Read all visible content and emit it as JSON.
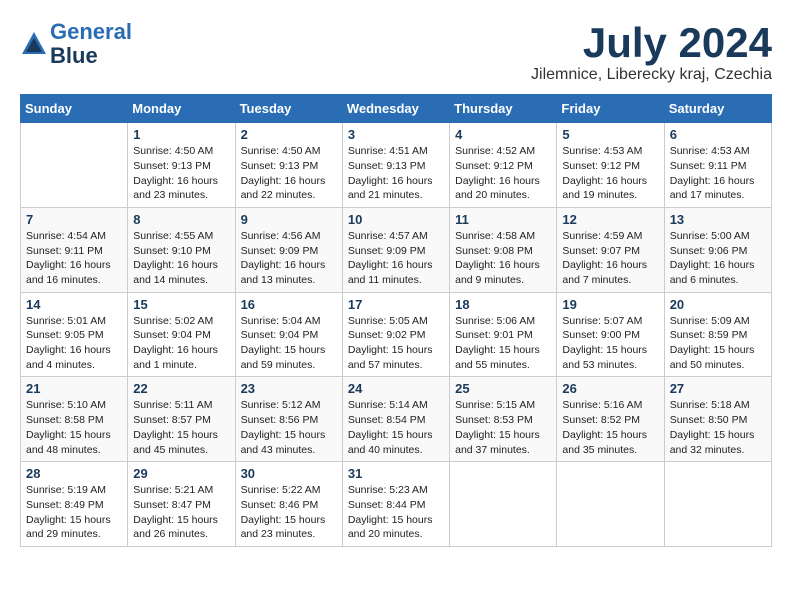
{
  "header": {
    "logo_line1": "General",
    "logo_line2": "Blue",
    "month": "July 2024",
    "location": "Jilemnice, Liberecky kraj, Czechia"
  },
  "weekdays": [
    "Sunday",
    "Monday",
    "Tuesday",
    "Wednesday",
    "Thursday",
    "Friday",
    "Saturday"
  ],
  "weeks": [
    [
      {
        "num": "",
        "text": ""
      },
      {
        "num": "1",
        "text": "Sunrise: 4:50 AM\nSunset: 9:13 PM\nDaylight: 16 hours\nand 23 minutes."
      },
      {
        "num": "2",
        "text": "Sunrise: 4:50 AM\nSunset: 9:13 PM\nDaylight: 16 hours\nand 22 minutes."
      },
      {
        "num": "3",
        "text": "Sunrise: 4:51 AM\nSunset: 9:13 PM\nDaylight: 16 hours\nand 21 minutes."
      },
      {
        "num": "4",
        "text": "Sunrise: 4:52 AM\nSunset: 9:12 PM\nDaylight: 16 hours\nand 20 minutes."
      },
      {
        "num": "5",
        "text": "Sunrise: 4:53 AM\nSunset: 9:12 PM\nDaylight: 16 hours\nand 19 minutes."
      },
      {
        "num": "6",
        "text": "Sunrise: 4:53 AM\nSunset: 9:11 PM\nDaylight: 16 hours\nand 17 minutes."
      }
    ],
    [
      {
        "num": "7",
        "text": "Sunrise: 4:54 AM\nSunset: 9:11 PM\nDaylight: 16 hours\nand 16 minutes."
      },
      {
        "num": "8",
        "text": "Sunrise: 4:55 AM\nSunset: 9:10 PM\nDaylight: 16 hours\nand 14 minutes."
      },
      {
        "num": "9",
        "text": "Sunrise: 4:56 AM\nSunset: 9:09 PM\nDaylight: 16 hours\nand 13 minutes."
      },
      {
        "num": "10",
        "text": "Sunrise: 4:57 AM\nSunset: 9:09 PM\nDaylight: 16 hours\nand 11 minutes."
      },
      {
        "num": "11",
        "text": "Sunrise: 4:58 AM\nSunset: 9:08 PM\nDaylight: 16 hours\nand 9 minutes."
      },
      {
        "num": "12",
        "text": "Sunrise: 4:59 AM\nSunset: 9:07 PM\nDaylight: 16 hours\nand 7 minutes."
      },
      {
        "num": "13",
        "text": "Sunrise: 5:00 AM\nSunset: 9:06 PM\nDaylight: 16 hours\nand 6 minutes."
      }
    ],
    [
      {
        "num": "14",
        "text": "Sunrise: 5:01 AM\nSunset: 9:05 PM\nDaylight: 16 hours\nand 4 minutes."
      },
      {
        "num": "15",
        "text": "Sunrise: 5:02 AM\nSunset: 9:04 PM\nDaylight: 16 hours\nand 1 minute."
      },
      {
        "num": "16",
        "text": "Sunrise: 5:04 AM\nSunset: 9:04 PM\nDaylight: 15 hours\nand 59 minutes."
      },
      {
        "num": "17",
        "text": "Sunrise: 5:05 AM\nSunset: 9:02 PM\nDaylight: 15 hours\nand 57 minutes."
      },
      {
        "num": "18",
        "text": "Sunrise: 5:06 AM\nSunset: 9:01 PM\nDaylight: 15 hours\nand 55 minutes."
      },
      {
        "num": "19",
        "text": "Sunrise: 5:07 AM\nSunset: 9:00 PM\nDaylight: 15 hours\nand 53 minutes."
      },
      {
        "num": "20",
        "text": "Sunrise: 5:09 AM\nSunset: 8:59 PM\nDaylight: 15 hours\nand 50 minutes."
      }
    ],
    [
      {
        "num": "21",
        "text": "Sunrise: 5:10 AM\nSunset: 8:58 PM\nDaylight: 15 hours\nand 48 minutes."
      },
      {
        "num": "22",
        "text": "Sunrise: 5:11 AM\nSunset: 8:57 PM\nDaylight: 15 hours\nand 45 minutes."
      },
      {
        "num": "23",
        "text": "Sunrise: 5:12 AM\nSunset: 8:56 PM\nDaylight: 15 hours\nand 43 minutes."
      },
      {
        "num": "24",
        "text": "Sunrise: 5:14 AM\nSunset: 8:54 PM\nDaylight: 15 hours\nand 40 minutes."
      },
      {
        "num": "25",
        "text": "Sunrise: 5:15 AM\nSunset: 8:53 PM\nDaylight: 15 hours\nand 37 minutes."
      },
      {
        "num": "26",
        "text": "Sunrise: 5:16 AM\nSunset: 8:52 PM\nDaylight: 15 hours\nand 35 minutes."
      },
      {
        "num": "27",
        "text": "Sunrise: 5:18 AM\nSunset: 8:50 PM\nDaylight: 15 hours\nand 32 minutes."
      }
    ],
    [
      {
        "num": "28",
        "text": "Sunrise: 5:19 AM\nSunset: 8:49 PM\nDaylight: 15 hours\nand 29 minutes."
      },
      {
        "num": "29",
        "text": "Sunrise: 5:21 AM\nSunset: 8:47 PM\nDaylight: 15 hours\nand 26 minutes."
      },
      {
        "num": "30",
        "text": "Sunrise: 5:22 AM\nSunset: 8:46 PM\nDaylight: 15 hours\nand 23 minutes."
      },
      {
        "num": "31",
        "text": "Sunrise: 5:23 AM\nSunset: 8:44 PM\nDaylight: 15 hours\nand 20 minutes."
      },
      {
        "num": "",
        "text": ""
      },
      {
        "num": "",
        "text": ""
      },
      {
        "num": "",
        "text": ""
      }
    ]
  ]
}
